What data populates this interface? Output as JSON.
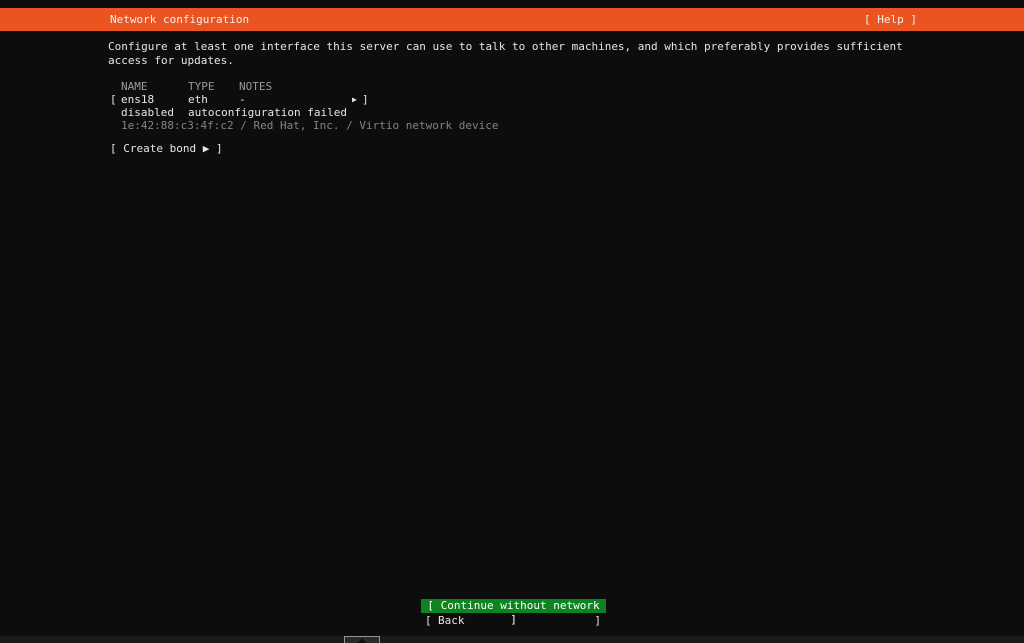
{
  "header": {
    "title": "Network configuration",
    "help_label": "[ Help ]"
  },
  "colors": {
    "accent_orange": "#E95420",
    "focus_green": "#0E8420",
    "background": "#0d0d0d"
  },
  "intro": {
    "line1": "Configure at least one interface this server can use to talk to other machines, and which preferably provides sufficient",
    "line2": "access for updates."
  },
  "interfaces": {
    "headers": {
      "name": "NAME",
      "type": "TYPE",
      "notes": "NOTES"
    },
    "row": {
      "bracket_open": "[",
      "name": "ens18",
      "type": "eth",
      "notes": "-",
      "arrow": "▶",
      "bracket_close": "]",
      "status": "disabled",
      "status_detail": "autoconfiguration failed",
      "hardware_info": "1e:42:88:c3:4f:c2 / Red Hat, Inc. / Virtio network device"
    },
    "create_bond_label": "[ Create bond ▶ ]"
  },
  "footer": {
    "continue_label": "[ Continue without network ]",
    "back": {
      "bracket_open": "[",
      "label": "Back",
      "bracket_close": "]"
    }
  }
}
